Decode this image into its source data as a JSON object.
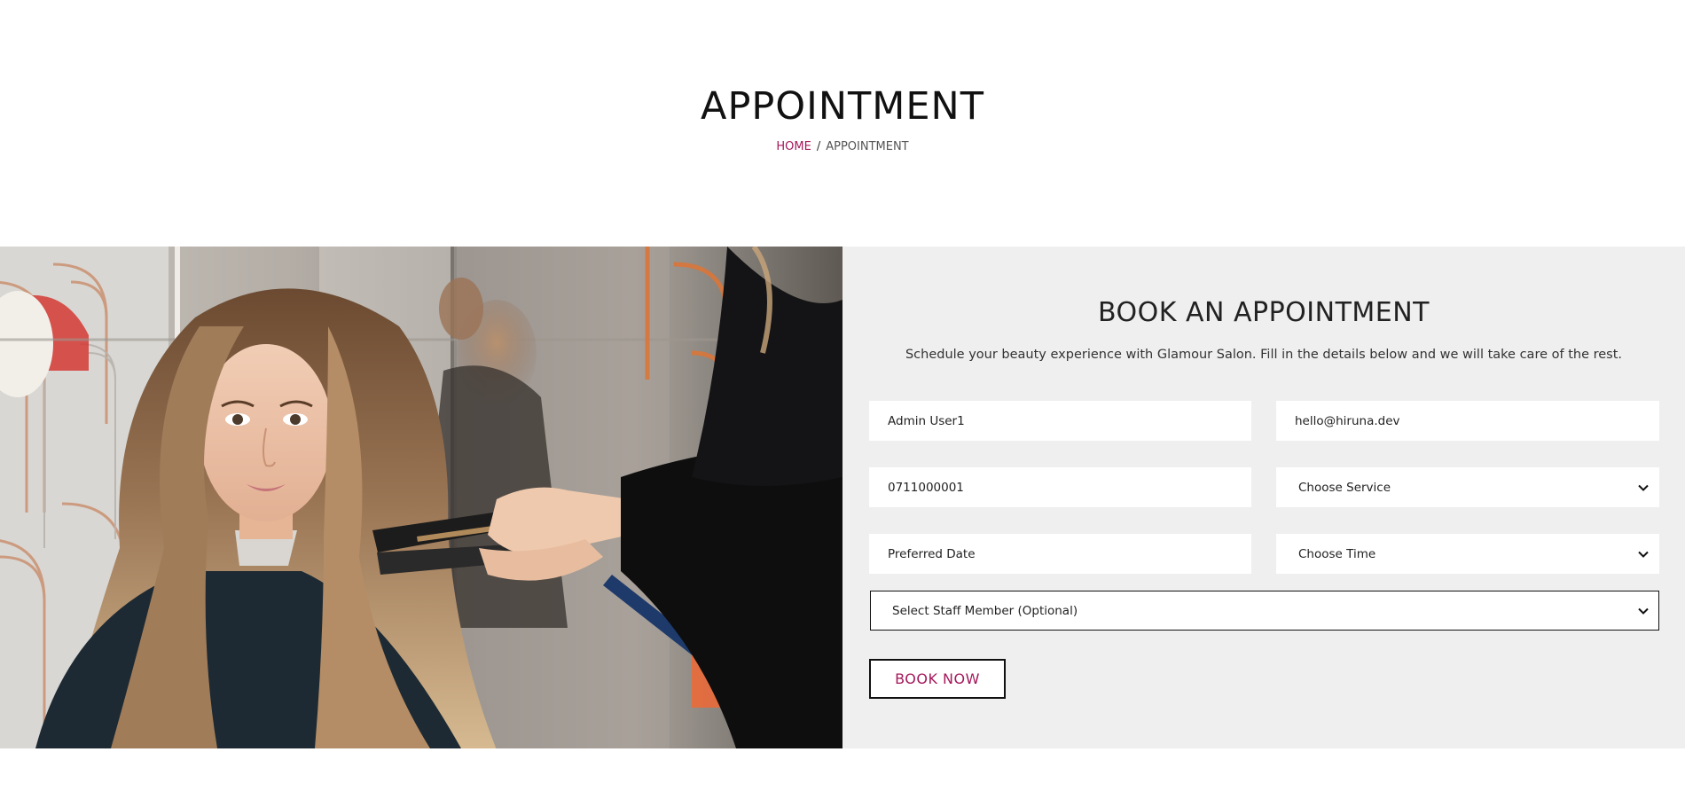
{
  "header": {
    "title": "APPOINTMENT",
    "breadcrumb": {
      "home": "HOME",
      "separator": "/",
      "current": "APPOINTMENT"
    }
  },
  "form": {
    "title": "BOOK AN APPOINTMENT",
    "subtitle": "Schedule your beauty experience with Glamour Salon. Fill in the details below and we will take care of the rest.",
    "name_value": "Admin User1",
    "email_value": "hello@hiruna.dev",
    "phone_value": "0711000001",
    "service_selected": "Choose Service",
    "date_placeholder": "Preferred Date",
    "time_selected": "Choose Time",
    "staff_selected": "Select Staff Member (Optional)",
    "submit_label": "BOOK NOW"
  },
  "colors": {
    "accent": "#a4185a",
    "panel_bg": "#efefef",
    "text": "#222222"
  },
  "icons": {
    "select_arrow": "chevron-down-icon"
  }
}
